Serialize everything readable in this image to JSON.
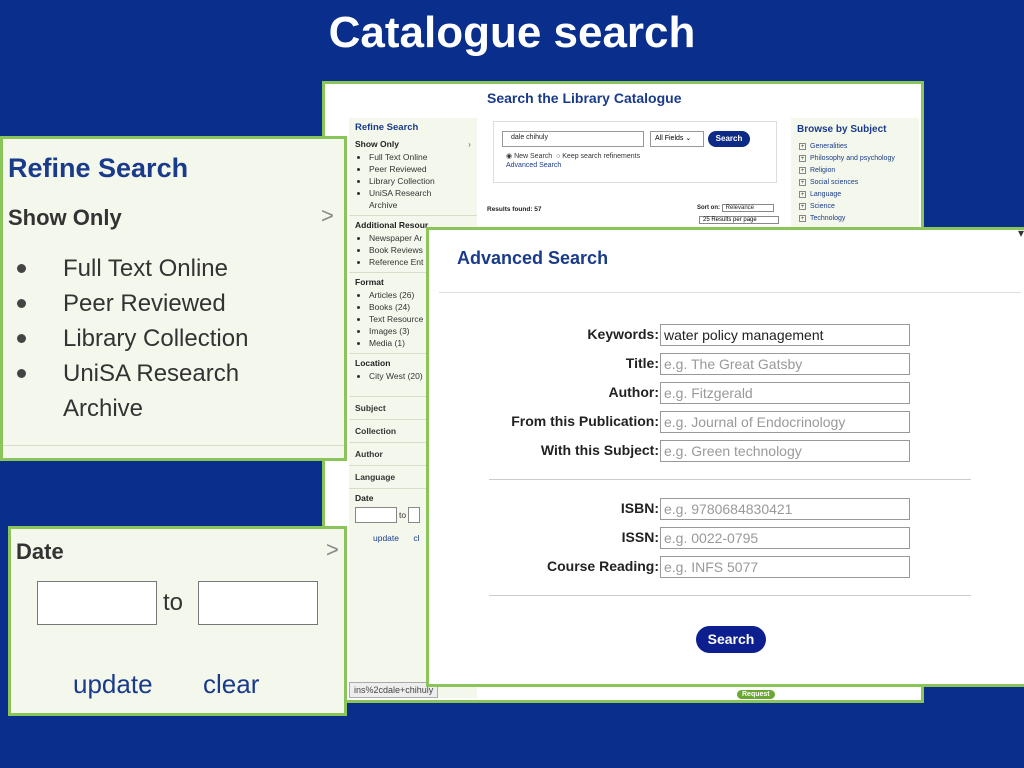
{
  "slide": {
    "title": "Catalogue search"
  },
  "main": {
    "heading": "Search the Library Catalogue",
    "refine_title": "Refine Search",
    "show_only": "Show Only",
    "show_only_items": [
      "Full Text Online",
      "Peer Reviewed",
      "Library Collection",
      "UniSA Research",
      "Archive"
    ],
    "additional_header": "Additional Resour",
    "additional_items": [
      "Newspaper Ar",
      "Book Reviews",
      "Reference Ent"
    ],
    "format_header": "Format",
    "format_items": [
      "Articles (26)",
      "Books (24)",
      "Text Resource",
      "Images (3)",
      "Media (1)"
    ],
    "location_header": "Location",
    "location_items": [
      "City West (20)"
    ],
    "subject": "Subject",
    "collection": "Collection",
    "author": "Author",
    "language": "Language",
    "date_header": "Date",
    "date_to": "to",
    "date_update": "update",
    "date_clear": "cl",
    "search_value": "dale chihuly",
    "field_select": "All Fields",
    "search_button": "Search",
    "radio_new": "New Search",
    "radio_keep": "Keep search refinements",
    "advanced_link": "Advanced Search",
    "results_found": "Results found: 57",
    "sort_label": "Sort on:",
    "sort_value": "Relevance",
    "per_page": "25 Results per page",
    "browse_title": "Browse by Subject",
    "browse_items": [
      "Generalities",
      "Philosophy and psychology",
      "Religion",
      "Social sciences",
      "Language",
      "Science",
      "Technology"
    ],
    "url_fragment": "ins%2cdale+chihuly",
    "request": "Request"
  },
  "refine_callout": {
    "title": "Refine Search",
    "show_only": "Show Only",
    "items": [
      "Full Text Online",
      "Peer Reviewed",
      "Library Collection",
      "UniSA Research",
      "Archive"
    ]
  },
  "date_callout": {
    "title": "Date",
    "to": "to",
    "update": "update",
    "clear": "clear"
  },
  "advanced": {
    "title": "Advanced Search",
    "keywords_label": "Keywords:",
    "keywords_value": "water policy management",
    "title_label": "Title:",
    "title_placeholder": "e.g. The Great Gatsby",
    "author_label": "Author:",
    "author_placeholder": "e.g. Fitzgerald",
    "publication_label": "From this Publication:",
    "publication_placeholder": "e.g. Journal of Endocrinology",
    "subject_label": "With this Subject:",
    "subject_placeholder": "e.g. Green technology",
    "isbn_label": "ISBN:",
    "isbn_placeholder": "e.g. 9780684830421",
    "issn_label": "ISSN:",
    "issn_placeholder": "e.g. 0022-0795",
    "course_label": "Course Reading:",
    "course_placeholder": "e.g. INFS 5077",
    "search_button": "Search"
  },
  "colors": {
    "background": "#0a2e8c",
    "frame": "#8ac55a",
    "brand": "#1a3a8a",
    "button": "#0d1f8e"
  }
}
